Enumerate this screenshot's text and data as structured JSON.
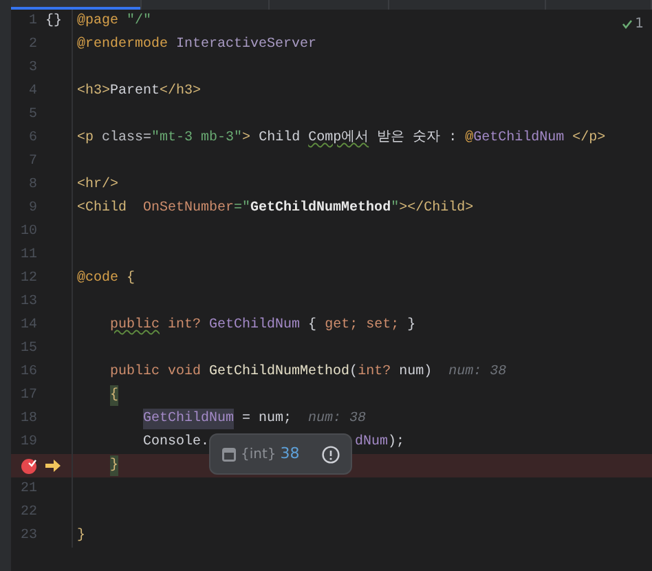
{
  "tabs": [
    {
      "selected": true
    },
    {
      "selected": false
    },
    {
      "selected": false
    },
    {
      "selected": false
    },
    {
      "selected": false
    }
  ],
  "inspection": {
    "text": "1"
  },
  "lines": [
    {
      "kind": "top",
      "number": "1",
      "gutter_text": "{}",
      "tokens": [
        {
          "text": "@page ",
          "kind": "directive"
        },
        {
          "text": "\"/\"",
          "kind": "string"
        }
      ]
    },
    {
      "kind": "top",
      "number": "2",
      "tokens": [
        {
          "text": "@rendermode ",
          "kind": "directive"
        },
        {
          "text": "InteractiveServer",
          "kind": "type"
        }
      ]
    },
    {
      "kind": "top",
      "number": "3"
    },
    {
      "kind": "top",
      "number": "4",
      "tokens": [
        {
          "text": "<h3>",
          "kind": "tag"
        },
        {
          "text": "Parent",
          "kind": "plain"
        },
        {
          "text": "</h3>",
          "kind": "tag"
        }
      ]
    },
    {
      "kind": "top",
      "number": "5"
    },
    {
      "kind": "top",
      "number": "6",
      "tokens": [
        {
          "text": "<p ",
          "kind": "tag"
        },
        {
          "text": "class=",
          "kind": "attr"
        },
        {
          "text": "\"mt-3 mb-3\"",
          "kind": "string"
        },
        {
          "text": ">",
          "kind": "tag"
        },
        {
          "text": " Child ",
          "kind": "plain"
        },
        {
          "text": "Comp에서",
          "kind": "typo"
        },
        {
          "text": " 받은 숫자 : ",
          "kind": "plain"
        },
        {
          "text": "@",
          "kind": "directive"
        },
        {
          "text": "GetChildNum ",
          "kind": "field"
        },
        {
          "text": "</p>",
          "kind": "tag"
        }
      ]
    },
    {
      "kind": "top",
      "number": "7"
    },
    {
      "kind": "top",
      "number": "8",
      "tokens": [
        {
          "text": "<hr/>",
          "kind": "tag"
        }
      ]
    },
    {
      "kind": "top",
      "number": "9",
      "tokens": [
        {
          "text": "<Child  ",
          "kind": "tag"
        },
        {
          "text": "OnSetNumber",
          "kind": "event_attr"
        },
        {
          "text": "=\"",
          "kind": "string"
        },
        {
          "text": "GetChildNumMethod",
          "kind": "method"
        },
        {
          "text": "\"",
          "kind": "string"
        },
        {
          "text": "></Child>",
          "kind": "tag"
        }
      ]
    },
    {
      "kind": "top",
      "number": "10"
    },
    {
      "kind": "top",
      "number": "11"
    },
    {
      "kind": "top",
      "number": "12",
      "tokens": [
        {
          "text": "@code",
          "kind": "directive"
        },
        {
          "text": " {",
          "kind": "brace"
        }
      ]
    },
    {
      "kind": "top",
      "number": "13"
    },
    {
      "kind": "member",
      "number": "14",
      "tokens": [
        {
          "text": "public",
          "kind": "keyword_typo"
        },
        {
          "text": " int?",
          "kind": "keyword"
        },
        {
          "text": " GetChildNum",
          "kind": "field"
        },
        {
          "text": " { ",
          "kind": "plain"
        },
        {
          "text": "get;",
          "kind": "keyword"
        },
        {
          "text": " set;",
          "kind": "keyword"
        },
        {
          "text": " }",
          "kind": "plain"
        }
      ]
    },
    {
      "kind": "top",
      "number": "15"
    },
    {
      "kind": "member",
      "number": "16",
      "tokens": [
        {
          "text": "public void",
          "kind": "keyword"
        },
        {
          "text": " GetChildNumMethod",
          "kind": "method_decl"
        },
        {
          "text": "(",
          "kind": "plain"
        },
        {
          "text": "int?",
          "kind": "keyword"
        },
        {
          "text": " num)",
          "kind": "plain"
        },
        {
          "text": "num: 38",
          "kind": "hint"
        }
      ]
    },
    {
      "kind": "member",
      "number": "17",
      "tokens": [
        {
          "text": "{",
          "kind": "brace_match"
        }
      ]
    },
    {
      "kind": "statement",
      "number": "18",
      "tokens": [
        {
          "text": "GetChildNum",
          "kind": "field_highlight"
        },
        {
          "text": " = num;",
          "kind": "plain"
        },
        {
          "text": "num: 38",
          "kind": "hint"
        }
      ]
    },
    {
      "kind": "statement",
      "number": "19",
      "tokens": [
        {
          "text": "Console.",
          "kind": "plain"
        },
        {
          "text": "dNum",
          "kind": "field_after_popup"
        },
        {
          "text": ");",
          "kind": "plain"
        }
      ]
    },
    {
      "kind": "member",
      "breakpoint": true,
      "execution_point": true,
      "tokens": [
        {
          "text": "}",
          "kind": "brace_match"
        }
      ]
    },
    {
      "kind": "top",
      "number": "21"
    },
    {
      "kind": "top",
      "number": "22"
    },
    {
      "kind": "top",
      "number": "23",
      "tokens": [
        {
          "text": "}",
          "kind": "brace"
        }
      ]
    }
  ],
  "popup": {
    "type": "{int}",
    "value": "38"
  }
}
